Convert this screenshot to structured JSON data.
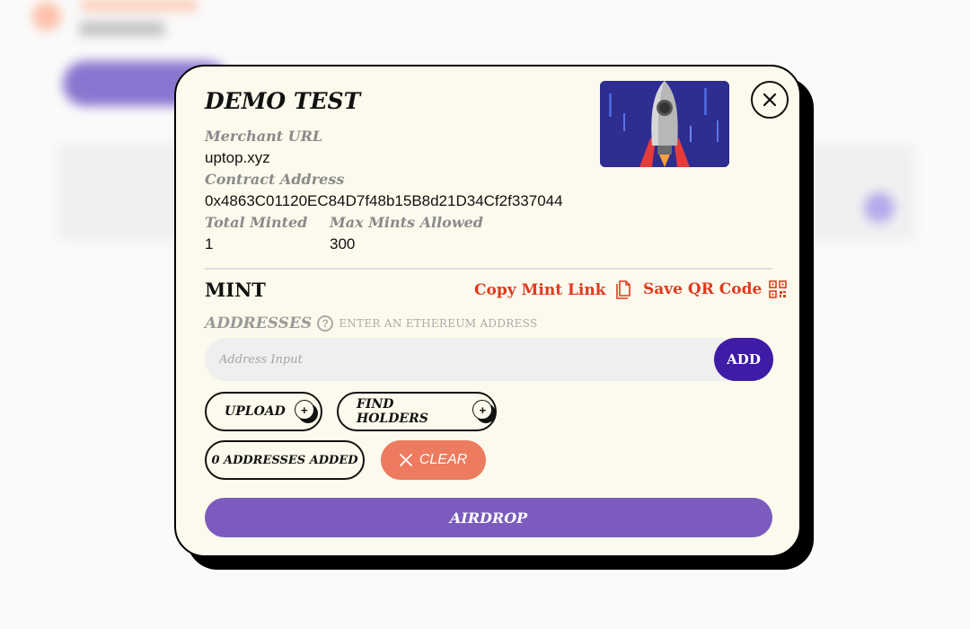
{
  "modal": {
    "title": "DEMO TEST",
    "merchant_url_label": "Merchant URL",
    "merchant_url": "uptop.xyz",
    "contract_address_label": "Contract Address",
    "contract_address": "0x4863C01120EC84D7f48b15B8d21D34Cf2f337044",
    "total_minted_label": "Total Minted",
    "total_minted": "1",
    "max_mints_label": "Max Mints Allowed",
    "max_mints": "300",
    "close_icon": "close-icon",
    "image_subject": "rocket-icon"
  },
  "mint": {
    "heading": "MINT",
    "copy_link_label": "Copy Mint Link",
    "copy_icon": "copy-icon",
    "save_qr_label": "Save QR Code",
    "qr_icon": "qr-code-icon",
    "addresses_label": "ADDRESSES",
    "help_icon": "help-icon",
    "addresses_hint": "ENTER AN ETHEREUM ADDRESS",
    "address_input_placeholder": "Address Input",
    "add_label": "ADD",
    "upload_label": "UPLOAD",
    "find_holders_label": "FIND HOLDERS",
    "addresses_added": "0 ADDRESSES ADDED",
    "clear_label": "CLEAR",
    "airdrop_label": "AIRDROP"
  },
  "colors": {
    "modal_bg": "#fcfaec",
    "accent_orange": "#e03a1e",
    "add_button": "#3f1ba6",
    "clear_button": "#ec7b5f",
    "airdrop_button": "#7b5cbe"
  }
}
